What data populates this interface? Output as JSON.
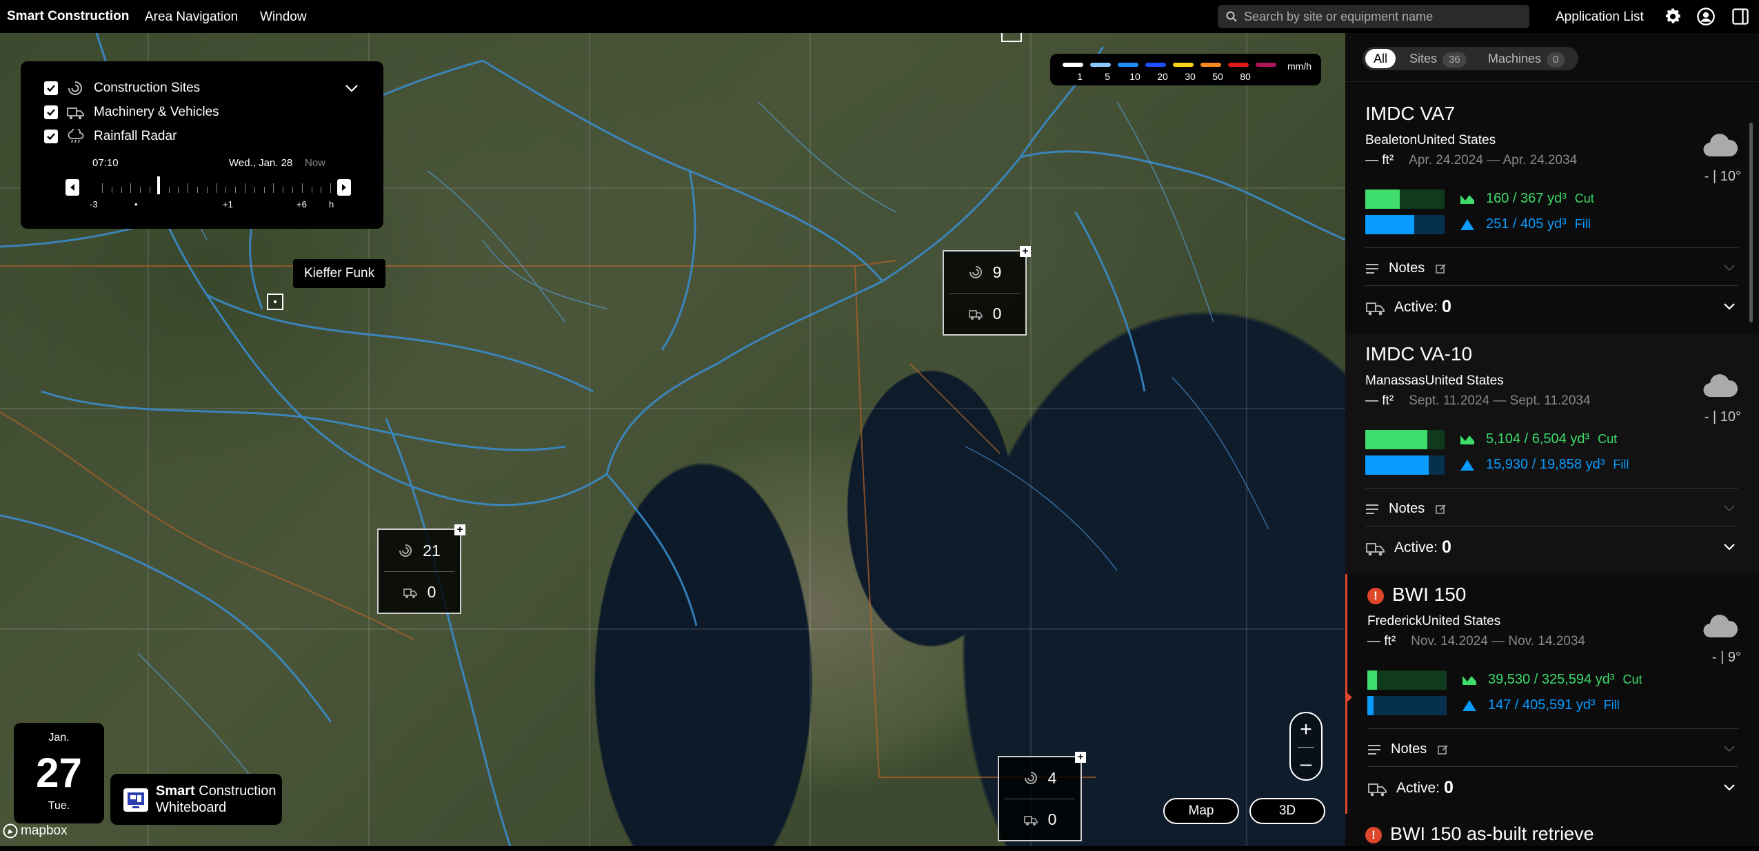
{
  "topbar": {
    "brand": "Smart Construction",
    "nav": [
      "Area Navigation",
      "Window"
    ],
    "search_placeholder": "Search by site or equipment name",
    "app_list": "Application List"
  },
  "layers": {
    "items": [
      {
        "label": "Construction Sites",
        "checked": true,
        "icon": "construction-site-icon"
      },
      {
        "label": "Machinery & Vehicles",
        "checked": true,
        "icon": "machinery-icon"
      },
      {
        "label": "Rainfall Radar",
        "checked": true,
        "icon": "rain-cloud-icon"
      }
    ],
    "timeline": {
      "time": "07:10",
      "date": "Wed., Jan. 28",
      "now": "Now",
      "ticks": [
        "-3",
        "•",
        "+1",
        "+6",
        "h"
      ]
    }
  },
  "legend": {
    "unit": "mm/h",
    "stops": [
      {
        "label": "1",
        "color": "#ffffff"
      },
      {
        "label": "5",
        "color": "#8cc8ff"
      },
      {
        "label": "10",
        "color": "#1e90ff"
      },
      {
        "label": "20",
        "color": "#1f4fff"
      },
      {
        "label": "30",
        "color": "#f7d21a"
      },
      {
        "label": "50",
        "color": "#f78a1a"
      },
      {
        "label": "80",
        "color": "#e01a1a"
      },
      {
        "label": "",
        "color": "#b0145a"
      }
    ]
  },
  "map": {
    "tooltip": "Kieffer Funk",
    "clusters": [
      {
        "sites": "21",
        "machines": "0"
      },
      {
        "sites": "9",
        "machines": "0"
      },
      {
        "sites": "4",
        "machines": "0"
      }
    ],
    "zoom_in": "+",
    "zoom_out": "–",
    "mode_map": "Map",
    "mode_3d": "3D",
    "attribution": "mapbox"
  },
  "date": {
    "month": "Jan.",
    "day": "27",
    "weekday": "Tue."
  },
  "whiteboard": {
    "line1_bold": "Smart",
    "line1_rest": " Construction",
    "line2": "Whiteboard"
  },
  "sidebar": {
    "filters": [
      {
        "label": "All"
      },
      {
        "label": "Sites",
        "count": "36"
      },
      {
        "label": "Machines",
        "count": "0"
      }
    ],
    "cards": [
      {
        "title": "IMDC VA7",
        "location": "BealetonUnited States",
        "area": "— ft²",
        "dates": "Apr. 24.2024 — Apr. 24.2034",
        "temp": "- | 10°",
        "cut": "160 / 367",
        "cut_unit": "yd³",
        "cut_label": "Cut",
        "cut_ratio": 0.436,
        "fill": "251 / 405",
        "fill_unit": "yd³",
        "fill_label": "Fill",
        "fill_ratio": 0.62,
        "notes": "Notes",
        "active_label": "Active:",
        "active_count": "0",
        "warning": false
      },
      {
        "title": "IMDC VA-10",
        "location": "ManassasUnited States",
        "area": "— ft²",
        "dates": "Sept. 11.2024 — Sept. 11.2034",
        "temp": "- | 10°",
        "cut": "5,104 / 6,504",
        "cut_unit": "yd³",
        "cut_label": "Cut",
        "cut_ratio": 0.785,
        "fill": "15,930 / 19,858",
        "fill_unit": "yd³",
        "fill_label": "Fill",
        "fill_ratio": 0.802,
        "notes": "Notes",
        "active_label": "Active:",
        "active_count": "0",
        "warning": false
      },
      {
        "title": "BWI 150",
        "location": "FrederickUnited States",
        "area": "— ft²",
        "dates": "Nov. 14.2024 — Nov. 14.2034",
        "temp": "- | 9°",
        "cut": "39,530 / 325,594",
        "cut_unit": "yd³",
        "cut_label": "Cut",
        "cut_ratio": 0.121,
        "fill": "147 / 405,591",
        "fill_unit": "yd³",
        "fill_label": "Fill",
        "fill_ratio": 0.08,
        "notes": "Notes",
        "active_label": "Active:",
        "active_count": "0",
        "warning": true
      }
    ],
    "next_title": "BWI 150 as-built retrieve",
    "colors": {
      "cut": "#3ddc6b",
      "cut_bg": "#0f3a1e",
      "fill": "#0a9bff",
      "fill_bg": "#06304d",
      "warning": "#e0462a"
    }
  }
}
